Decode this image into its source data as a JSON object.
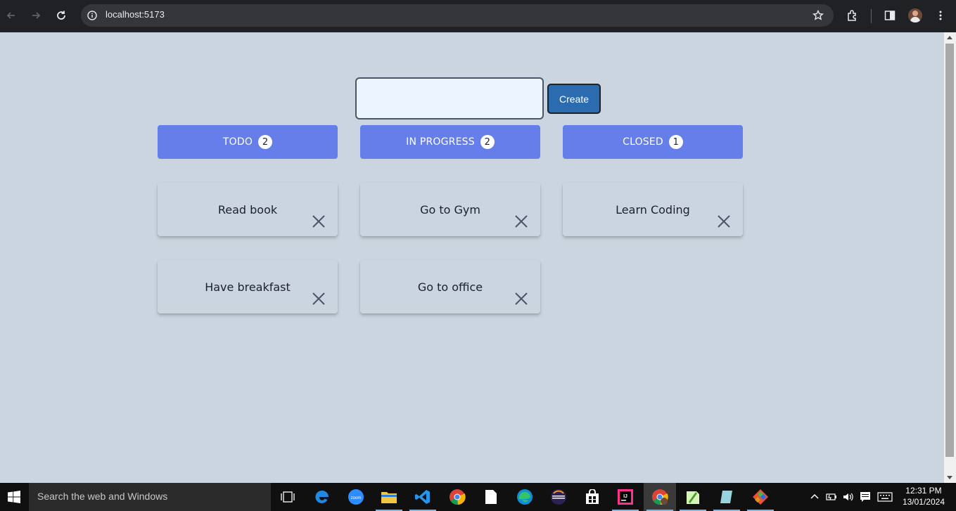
{
  "browser": {
    "url": "localhost:5173"
  },
  "form": {
    "input_value": "",
    "create_label": "Create"
  },
  "columns": [
    {
      "title": "TODO",
      "count": "2",
      "tasks": [
        "Read book",
        "Have breakfast"
      ]
    },
    {
      "title": "IN PROGRESS",
      "count": "2",
      "tasks": [
        "Go to Gym",
        "Go to office"
      ]
    },
    {
      "title": "CLOSED",
      "count": "1",
      "tasks": [
        "Learn Coding"
      ]
    }
  ],
  "taskbar": {
    "search_placeholder": "Search the web and Windows",
    "apps": [
      "task-view-icon",
      "edge-legacy-icon",
      "zoom-icon",
      "file-explorer-icon",
      "vscode-icon",
      "chrome-icon",
      "notepad-icon",
      "edge-icon",
      "eclipse-icon",
      "store-icon",
      "intellij-icon",
      "chrome-profile-icon",
      "notepadpp-icon",
      "sticky-icon",
      "git-icon"
    ],
    "time": "12:31 PM",
    "date": "13/01/2024"
  },
  "colors": {
    "page_bg": "#cbd5e0",
    "header_bg": "#667eea",
    "button_bg": "#2b6cb0",
    "input_bg": "#ebf4ff"
  }
}
